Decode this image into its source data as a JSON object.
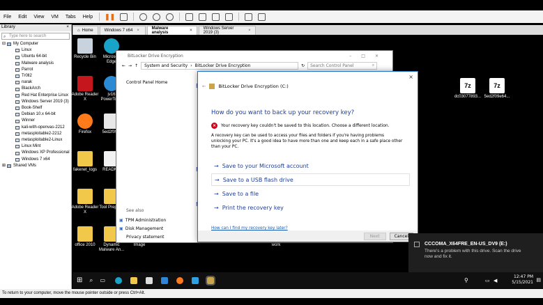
{
  "menu": [
    "File",
    "Edit",
    "View",
    "VM",
    "Tabs",
    "Help"
  ],
  "library": {
    "title": "Library",
    "close": "×",
    "search_placeholder": "Type here to search",
    "root": "My Computer",
    "vms": [
      "Linux",
      "Ubuntu 64-bit",
      "Malware analysis",
      "Parrot",
      "Tr0ll2",
      "narak",
      "BlackArch",
      "Red Hat Enterprise Linux",
      "Windows Server 2019 (3)",
      "Book-Shelf",
      "Debian 10.x 64-bit",
      "Winner",
      "kali-with-openvas-2212",
      "metasploitable2-2212",
      "metasploitable2-Linux",
      "Linux Mint",
      "Windows XP Professional",
      "Windows 7 x64"
    ],
    "shared": "Shared VMs"
  },
  "tabs": [
    {
      "label": "Home"
    },
    {
      "label": "Windows 7 x64"
    },
    {
      "label": "Malware analysis"
    },
    {
      "label": "Windows Server 2019 (3)"
    }
  ],
  "desktop_icons": [
    "Recycle Bin",
    "Microsoft Edge",
    "Adobe Reader X",
    "jv16 PowerTools",
    "Firefox",
    "5ed2f09...",
    "fakenet_logs",
    "README",
    "Adobe Reader X",
    "Tool Prepar...",
    "office 2010",
    "Dynamic Malware An...",
    "Image",
    "work",
    "dc03077893...",
    "5ed2f09e64..."
  ],
  "back_window": {
    "title": "BitLocker Drive Encryption",
    "breadcrumb1": "System and Security",
    "breadcrumb2": "BitLocker Drive Encryption",
    "search_placeholder": "Search Control Panel",
    "cp_home": "Control Panel Home",
    "see_also": "See also",
    "links": [
      "TPM Administration",
      "Disk Management",
      "Privacy statement"
    ],
    "frag_b": "B",
    "frag_f": "F"
  },
  "dialog": {
    "title": "BitLocker Drive Encryption (C:)",
    "heading": "How do you want to back up your recovery key?",
    "warning": "Your recovery key couldn't be saved to this location. Choose a different location.",
    "description": "A recovery key can be used to access your files and folders if you're having problems unlocking your PC. It's a good idea to have more than one and keep each in a safe place other than your PC.",
    "options": [
      "Save to your Microsoft account",
      "Save to a USB flash drive",
      "Save to a file",
      "Print the recovery key"
    ],
    "help_link": "How can I find my recovery key later?",
    "next": "Next",
    "cancel": "Cancel"
  },
  "toast": {
    "title": "CCCOMA_X64FRE_EN-US_DV9 (E:)",
    "body": "There's a problem with this drive.  Scan the drive now and fix it."
  },
  "clock": {
    "time": "12:47 PM",
    "date": "5/15/2021"
  },
  "status_bar": "To return to your computer, move the mouse pointer outside or press Ctrl+Alt.",
  "colors": {
    "accent": "#1f3e99",
    "link": "#1558b0",
    "error": "#d0021b",
    "vmware_orange": "#e0701e"
  }
}
